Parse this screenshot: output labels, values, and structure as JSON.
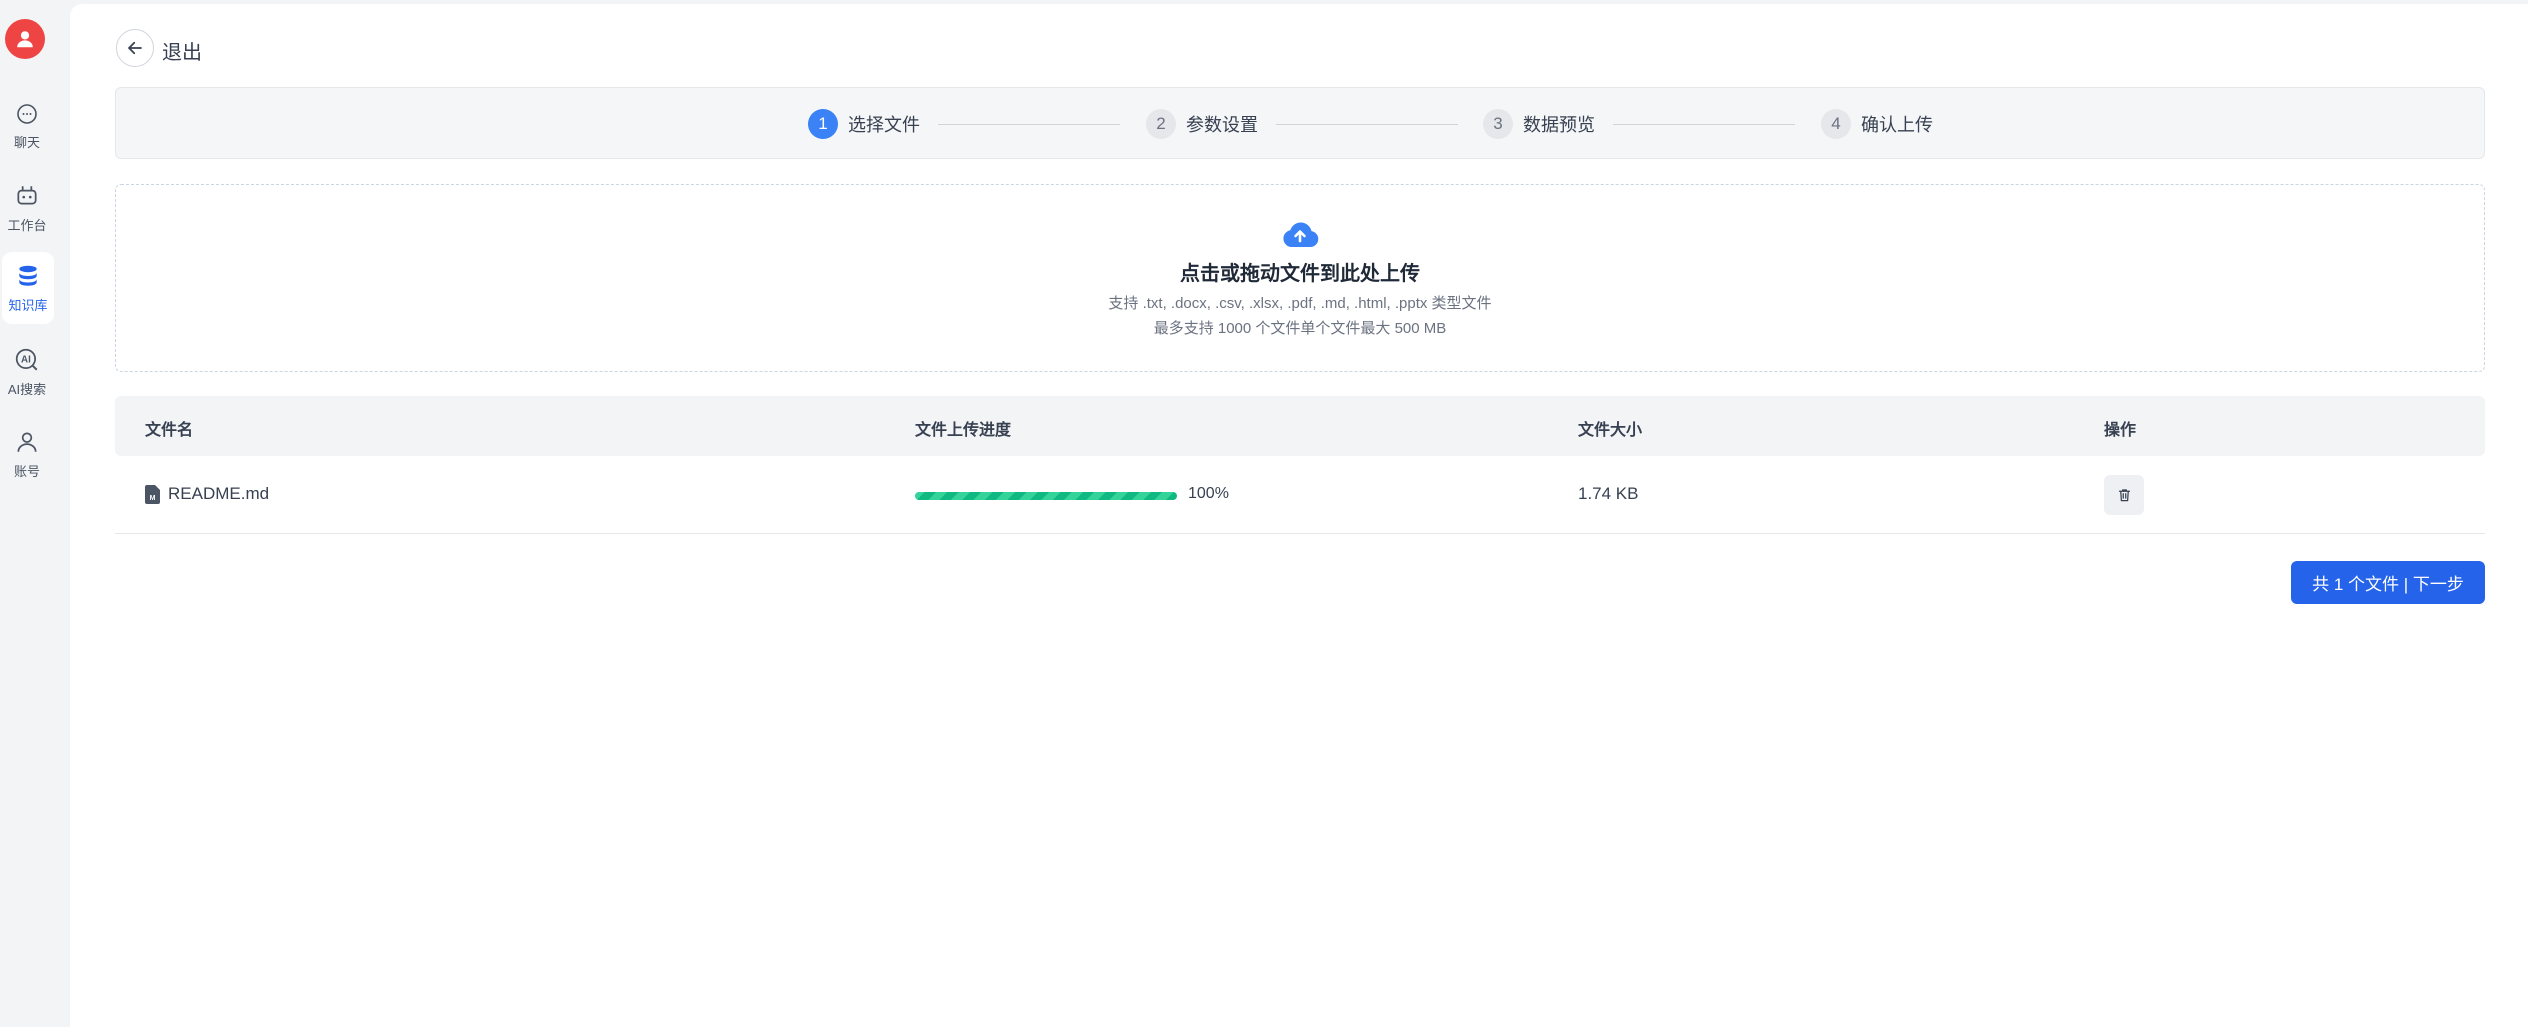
{
  "sidebar": {
    "items": [
      {
        "label": "聊天",
        "icon": "chat-icon"
      },
      {
        "label": "工作台",
        "icon": "robot-icon"
      },
      {
        "label": "知识库",
        "icon": "database-icon",
        "active": true
      },
      {
        "label": "AI搜索",
        "icon": "ai-search-icon"
      },
      {
        "label": "账号",
        "icon": "user-icon"
      }
    ]
  },
  "header": {
    "back_label": "退出"
  },
  "steps": [
    {
      "num": "1",
      "label": "选择文件",
      "active": true
    },
    {
      "num": "2",
      "label": "参数设置"
    },
    {
      "num": "3",
      "label": "数据预览"
    },
    {
      "num": "4",
      "label": "确认上传"
    }
  ],
  "upload": {
    "title": "点击或拖动文件到此处上传",
    "hint": "支持 .txt, .docx, .csv, .xlsx, .pdf, .md, .html, .pptx 类型文件",
    "limit": "最多支持 1000 个文件单个文件最大 500 MB"
  },
  "table": {
    "columns": [
      "文件名",
      "文件上传进度",
      "文件大小",
      "操作"
    ],
    "rows": [
      {
        "name": "README.md",
        "progress_pct": "100%",
        "progress": 1.0,
        "size": "1.74 KB"
      }
    ]
  },
  "footer": {
    "next_label": "共 1 个文件 | 下一步"
  },
  "colors": {
    "accent": "#2563eb",
    "progress": "#10b981",
    "avatar": "#ef4444"
  }
}
